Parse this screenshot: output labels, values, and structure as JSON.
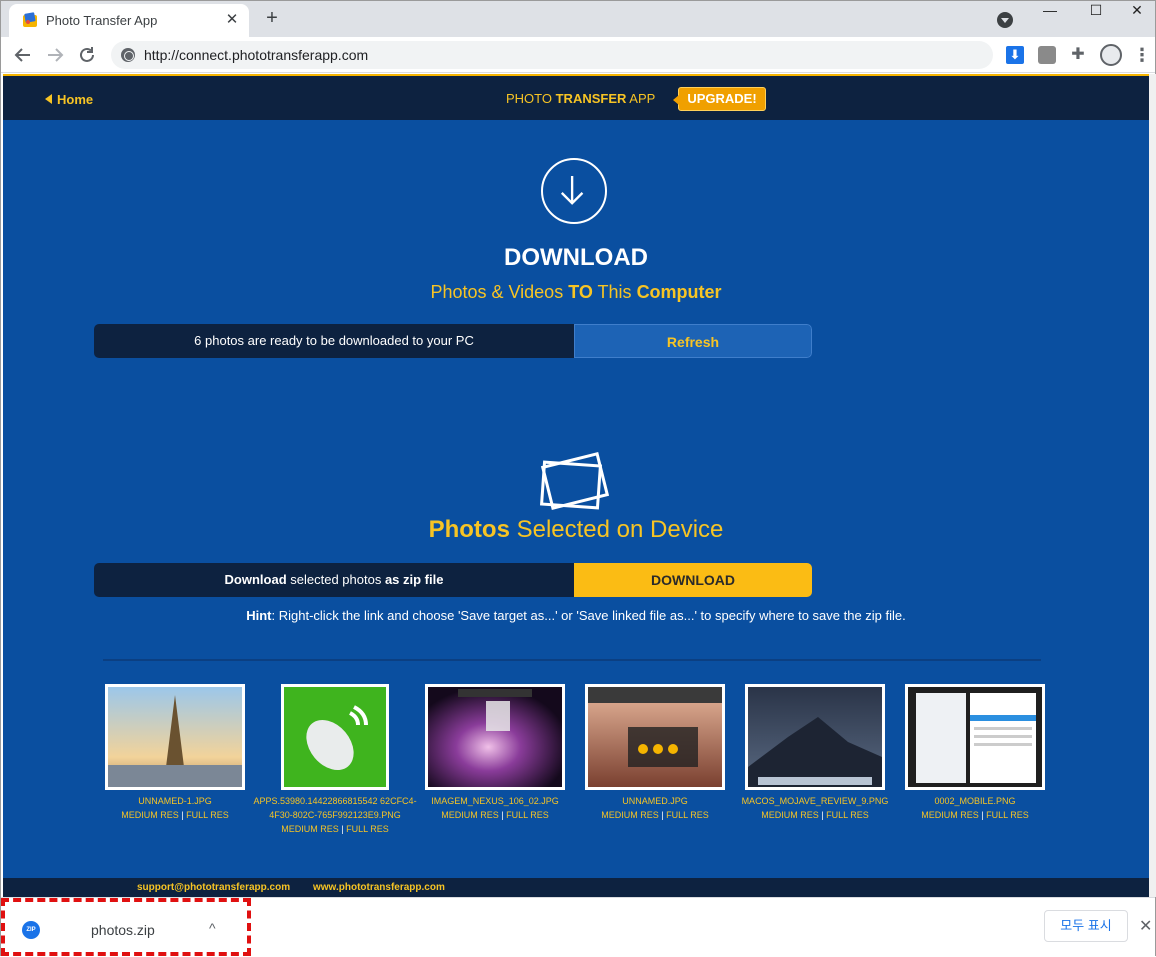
{
  "browser": {
    "tab_title": "Photo Transfer App",
    "tab_close": "✕",
    "new_tab": "+",
    "url": "http://connect.phototransferapp.com",
    "window_minimize": "—",
    "window_maximize": "☐",
    "window_close": "✕",
    "ext_download_arrow": "⬇",
    "ext_menu": "⋮",
    "ext_puzzle": "✚"
  },
  "header": {
    "home_label": "Home",
    "brand_prefix": "PHOTO ",
    "brand_bold": "TRANSFER",
    "brand_suffix": " APP",
    "upgrade_label": "UPGRADE!"
  },
  "download_section": {
    "title": "DOWNLOAD",
    "subtitle_parts": [
      "Photos & Videos ",
      "TO",
      " This ",
      "Computer"
    ],
    "status_text": "6 photos are ready to be downloaded to your PC",
    "refresh_label": "Refresh"
  },
  "photos_section": {
    "title_bold": "Photos",
    "title_rest": " Selected on Device",
    "zip_parts": [
      "Download",
      " selected photos ",
      "as zip file"
    ],
    "download_label": "DOWNLOAD",
    "hint_bold": "Hint",
    "hint_text": ": Right-click the link and choose 'Save target as...' or 'Save linked file as...' to specify where to save the zip file."
  },
  "thumbnails": [
    {
      "name": "UNNAMED-1.JPG",
      "medium": "MEDIUM RES",
      "full": "FULL RES"
    },
    {
      "name": "APPS.53980.14422866815542 62CFC4-4F30-802C-765F992123E9.PNG",
      "medium": "MEDIUM RES",
      "full": "FULL RES"
    },
    {
      "name": "IMAGEM_NEXUS_106_02.JPG",
      "medium": "MEDIUM RES",
      "full": "FULL RES"
    },
    {
      "name": "UNNAMED.JPG",
      "medium": "MEDIUM RES",
      "full": "FULL RES"
    },
    {
      "name": "MACOS_MOJAVE_REVIEW_9.PNG",
      "medium": "MEDIUM RES",
      "full": "FULL RES"
    },
    {
      "name": "0002_MOBILE.PNG",
      "medium": "MEDIUM RES",
      "full": "FULL RES"
    }
  ],
  "thumb_sep": "|",
  "footer": {
    "email": "support@phototransferapp.com",
    "website": "www.phototransferapp.com"
  },
  "download_shelf": {
    "file_name": "photos.zip",
    "file_icon_text": "ZIP",
    "chevron": "^",
    "show_all_label": "모두 표시",
    "close": "✕"
  },
  "colors": {
    "page_blue": "#0a4fa0",
    "header_navy": "#0d2240",
    "accent_yellow": "#f7c424",
    "download_button": "#fbbc14",
    "highlight_dashed": "#e01010"
  }
}
